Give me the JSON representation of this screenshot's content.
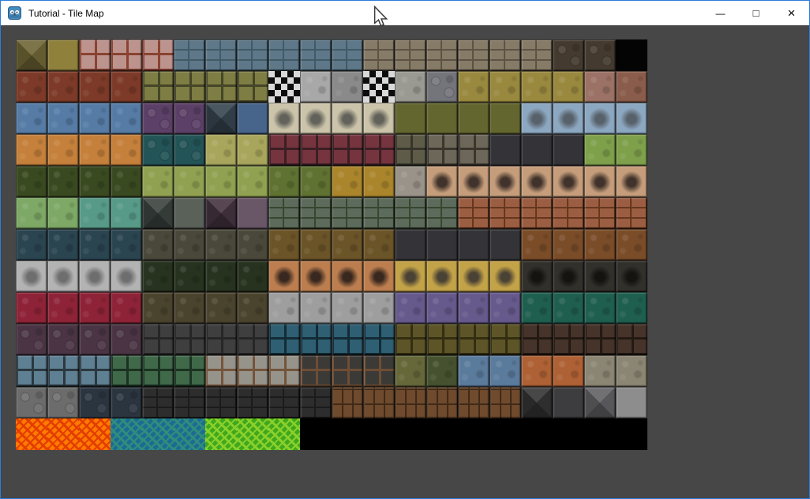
{
  "window": {
    "title": "Tutorial - Tile Map",
    "app_icon": "godot-icon",
    "controls": {
      "minimize": "—",
      "maximize": "□",
      "close": "×"
    }
  },
  "theme": {
    "border": "#2b7cd9",
    "titlebar_bg": "#ffffff",
    "title_color": "#000000",
    "content_bg": "#474747"
  },
  "tileset": {
    "description": "tile-map tileset image, 20 columns x 13 rows of 40px tiles at (20,50)",
    "tile_size": 40,
    "cols": 20,
    "rows_count": 13,
    "rows": [
      [
        {
          "n": 1,
          "t": "pyr",
          "c": "#6f6535"
        },
        {
          "n": 1,
          "t": "flat",
          "c": "#8f813c"
        },
        {
          "n": 3,
          "t": "sq",
          "c": "#bd938d",
          "c2": "#8a4231"
        },
        {
          "n": 6,
          "t": "brick",
          "c": "#5e7889",
          "c2": "#415a67"
        },
        {
          "n": 6,
          "t": "brick",
          "c": "#867b67",
          "c2": "#5d5344"
        },
        {
          "n": 2,
          "t": "cob",
          "c": "#443a2f"
        },
        {
          "n": 1,
          "t": "plain",
          "c": "#040404"
        }
      ],
      [
        {
          "n": 4,
          "t": "mot",
          "c": "#7d3a28"
        },
        {
          "n": 4,
          "t": "sq",
          "c": "#7d7d44",
          "c2": "#454527"
        },
        {
          "n": 1,
          "t": "check",
          "c": "#0d0d0d",
          "c2": "#d9d9d9"
        },
        {
          "n": 1,
          "t": "mot",
          "c": "#a8a8a8"
        },
        {
          "n": 1,
          "t": "mot",
          "c": "#8a8a8a"
        },
        {
          "n": 1,
          "t": "check",
          "c": "#0d0d0d",
          "c2": "#d9d9d9"
        },
        {
          "n": 1,
          "t": "mot",
          "c": "#9a9a93"
        },
        {
          "n": 1,
          "t": "cob",
          "c": "#74747b"
        },
        {
          "n": 4,
          "t": "mot",
          "c": "#99893f"
        },
        {
          "n": 1,
          "t": "mot",
          "c": "#9b7265"
        },
        {
          "n": 1,
          "t": "mot",
          "c": "#8a5c4b"
        }
      ],
      [
        {
          "n": 4,
          "t": "mot",
          "c": "#567ca6"
        },
        {
          "n": 2,
          "t": "cob",
          "c": "#5c4067"
        },
        {
          "n": 1,
          "t": "pyr",
          "c": "#36444f"
        },
        {
          "n": 1,
          "t": "flat",
          "c": "#47648a"
        },
        {
          "n": 4,
          "t": "smud",
          "c": "#ccc4aa",
          "c2": "#62625a"
        },
        {
          "n": 4,
          "t": "flat",
          "c": "#64662f"
        },
        {
          "n": 4,
          "t": "smud",
          "c": "#8ca7c0",
          "c2": "#57616a"
        }
      ],
      [
        {
          "n": 4,
          "t": "mot",
          "c": "#c5803b"
        },
        {
          "n": 2,
          "t": "cob",
          "c": "#235457"
        },
        {
          "n": 2,
          "t": "mot",
          "c": "#a8a65c"
        },
        {
          "n": 4,
          "t": "sq",
          "c": "#76343e",
          "c2": "#3a1f24"
        },
        {
          "n": 1,
          "t": "sq",
          "c": "#5e5c49",
          "c2": "#35352b"
        },
        {
          "n": 2,
          "t": "sq",
          "c": "#6d675a",
          "c2": "#3a362e"
        },
        {
          "n": 3,
          "t": "flat",
          "c": "#343438"
        },
        {
          "n": 2,
          "t": "mot",
          "c": "#7fa04b"
        }
      ],
      [
        {
          "n": 4,
          "t": "mot",
          "c": "#3a4a20"
        },
        {
          "n": 4,
          "t": "mot",
          "c": "#90a151"
        },
        {
          "n": 2,
          "t": "mot",
          "c": "#5f7231"
        },
        {
          "n": 2,
          "t": "mot",
          "c": "#aa852c"
        },
        {
          "n": 1,
          "t": "mot",
          "c": "#99938a"
        },
        {
          "n": 7,
          "t": "smud",
          "c": "#c59d7b",
          "c2": "#41332b"
        }
      ],
      [
        {
          "n": 2,
          "t": "mot",
          "c": "#7da865"
        },
        {
          "n": 2,
          "t": "mot",
          "c": "#579a88"
        },
        {
          "n": 1,
          "t": "pyr",
          "c": "#3a423e"
        },
        {
          "n": 1,
          "t": "flat",
          "c": "#596158"
        },
        {
          "n": 1,
          "t": "pyr",
          "c": "#453340"
        },
        {
          "n": 1,
          "t": "flat",
          "c": "#695666"
        },
        {
          "n": 6,
          "t": "brick",
          "c": "#5d6b5c",
          "c2": "#39462f"
        },
        {
          "n": 6,
          "t": "brick",
          "c": "#9c5e42",
          "c2": "#66371f"
        }
      ],
      [
        {
          "n": 4,
          "t": "mot",
          "c": "#2a4450"
        },
        {
          "n": 4,
          "t": "mot",
          "c": "#49483a"
        },
        {
          "n": 4,
          "t": "mot",
          "c": "#6b5428"
        },
        {
          "n": 4,
          "t": "flat",
          "c": "#343438"
        },
        {
          "n": 4,
          "t": "mot",
          "c": "#7a4c28"
        }
      ],
      [
        {
          "n": 4,
          "t": "smud",
          "c": "#b3b3b3",
          "c2": "#6e6e6e"
        },
        {
          "n": 4,
          "t": "mot",
          "c": "#27331f"
        },
        {
          "n": 4,
          "t": "smud",
          "c": "#bd7e4f",
          "c2": "#39281f"
        },
        {
          "n": 4,
          "t": "smud",
          "c": "#c3a348",
          "c2": "#4a4234"
        },
        {
          "n": 4,
          "t": "smud",
          "c": "#32302b",
          "c2": "#15130f"
        }
      ],
      [
        {
          "n": 4,
          "t": "mot",
          "c": "#8e2337"
        },
        {
          "n": 4,
          "t": "mot",
          "c": "#4a432d"
        },
        {
          "n": 4,
          "t": "mot",
          "c": "#9e9e9e"
        },
        {
          "n": 4,
          "t": "mot",
          "c": "#66598c"
        },
        {
          "n": 4,
          "t": "mot",
          "c": "#1f5f50"
        }
      ],
      [
        {
          "n": 4,
          "t": "cob",
          "c": "#4b3545"
        },
        {
          "n": 4,
          "t": "sq",
          "c": "#3f3f3f",
          "c2": "#262626"
        },
        {
          "n": 4,
          "t": "sq",
          "c": "#2f5f73",
          "c2": "#132b35"
        },
        {
          "n": 4,
          "t": "sq",
          "c": "#5d5527",
          "c2": "#332e12"
        },
        {
          "n": 4,
          "t": "sq",
          "c": "#46332a",
          "c2": "#241913"
        }
      ],
      [
        {
          "n": 3,
          "t": "sq",
          "c": "#5f7f92",
          "c2": "#2a3840"
        },
        {
          "n": 3,
          "t": "sq",
          "c": "#40694a",
          "c2": "#1b3322"
        },
        {
          "n": 3,
          "t": "sq",
          "c": "#96938b",
          "c2": "#74543a"
        },
        {
          "n": 3,
          "t": "sq",
          "c": "#3b3a36",
          "c2": "#6e4e34"
        },
        {
          "n": 1,
          "t": "mot",
          "c": "#67683a"
        },
        {
          "n": 1,
          "t": "mot",
          "c": "#46522f"
        },
        {
          "n": 2,
          "t": "mot",
          "c": "#5b7b9d"
        },
        {
          "n": 2,
          "t": "mot",
          "c": "#ae6134"
        },
        {
          "n": 2,
          "t": "mot",
          "c": "#8b8573"
        }
      ],
      [
        {
          "n": 2,
          "t": "cob",
          "c": "#6c6c6c"
        },
        {
          "n": 2,
          "t": "cob",
          "c": "#2b3540"
        },
        {
          "n": 6,
          "t": "brick",
          "c": "#2d2d2d",
          "c2": "#1b1b1b"
        },
        {
          "n": 6,
          "t": "plank",
          "c": "#6f4a2d",
          "c2": "#402a18"
        },
        {
          "n": 1,
          "t": "pyr",
          "c": "#333333"
        },
        {
          "n": 1,
          "t": "flat",
          "c": "#3d3d40"
        },
        {
          "n": 1,
          "t": "pyr",
          "c": "#616165"
        },
        {
          "n": 1,
          "t": "flat",
          "c": "#8d8d8d"
        }
      ],
      [
        {
          "n": 3,
          "t": "liq",
          "c": "#ff7b00",
          "c2": "#e33d00"
        },
        {
          "n": 3,
          "t": "liq",
          "c": "#1d6b95",
          "c2": "#2f8e7a"
        },
        {
          "n": 3,
          "t": "liq",
          "c": "#3fa81e",
          "c2": "#8bd02a"
        },
        {
          "n": 11,
          "t": "plain",
          "c": "#000000"
        }
      ]
    ]
  }
}
